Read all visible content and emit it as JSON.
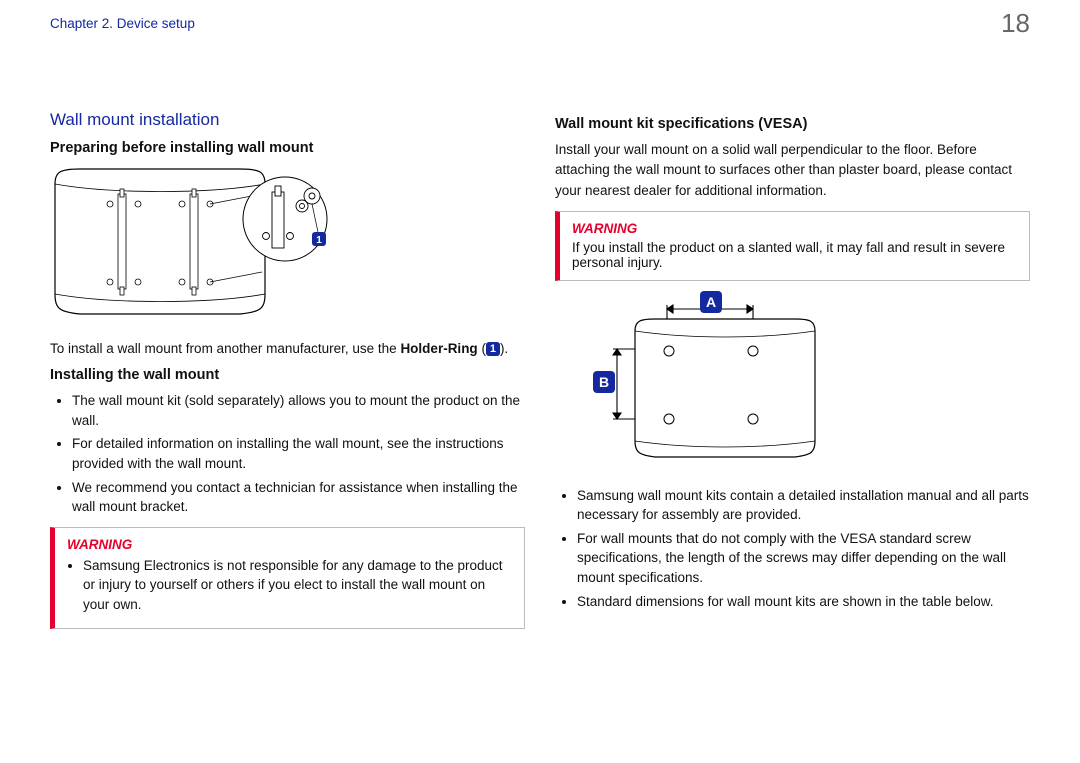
{
  "header": {
    "chapter": "Chapter 2. Device setup",
    "page_number": "18"
  },
  "left": {
    "section_title": "Wall mount installation",
    "sub_preparing": "Preparing before installing wall mount",
    "ring_note_pre": "To install a wall mount from another manufacturer, use the ",
    "ring_note_bold": "Holder-Ring",
    "ring_note_open": " (",
    "ring_badge": "1",
    "ring_note_close": ").",
    "sub_installing": "Installing the wall mount",
    "install_bullets": [
      "The wall mount kit (sold separately) allows you to mount the product on the wall.",
      "For detailed information on installing the wall mount, see the instructions provided with the wall mount.",
      "We recommend you contact a technician for assistance when installing the wall mount bracket."
    ],
    "warning_label": "WARNING",
    "warning_bullets": [
      "Samsung Electronics is not responsible for any damage to the product or injury to yourself or others if you elect to install the wall mount on your own."
    ]
  },
  "right": {
    "sub_vesa": "Wall mount kit specifications (VESA)",
    "vesa_intro": "Install your wall mount on a solid wall perpendicular to the floor. Before attaching the wall mount to surfaces other than plaster board, please contact your nearest dealer for additional information.",
    "warning_label": "WARNING",
    "warning_text": "If you install the product on a slanted wall, it may fall and result in severe personal injury.",
    "label_a": "A",
    "label_b": "B",
    "vesa_bullets": [
      "Samsung wall mount kits contain a detailed installation manual and all parts necessary for assembly are provided.",
      "For wall mounts that do not comply with the VESA standard screw specifications, the length of the screws may differ depending on the wall mount specifications.",
      "Standard dimensions for wall mount kits are shown in the table below."
    ]
  }
}
